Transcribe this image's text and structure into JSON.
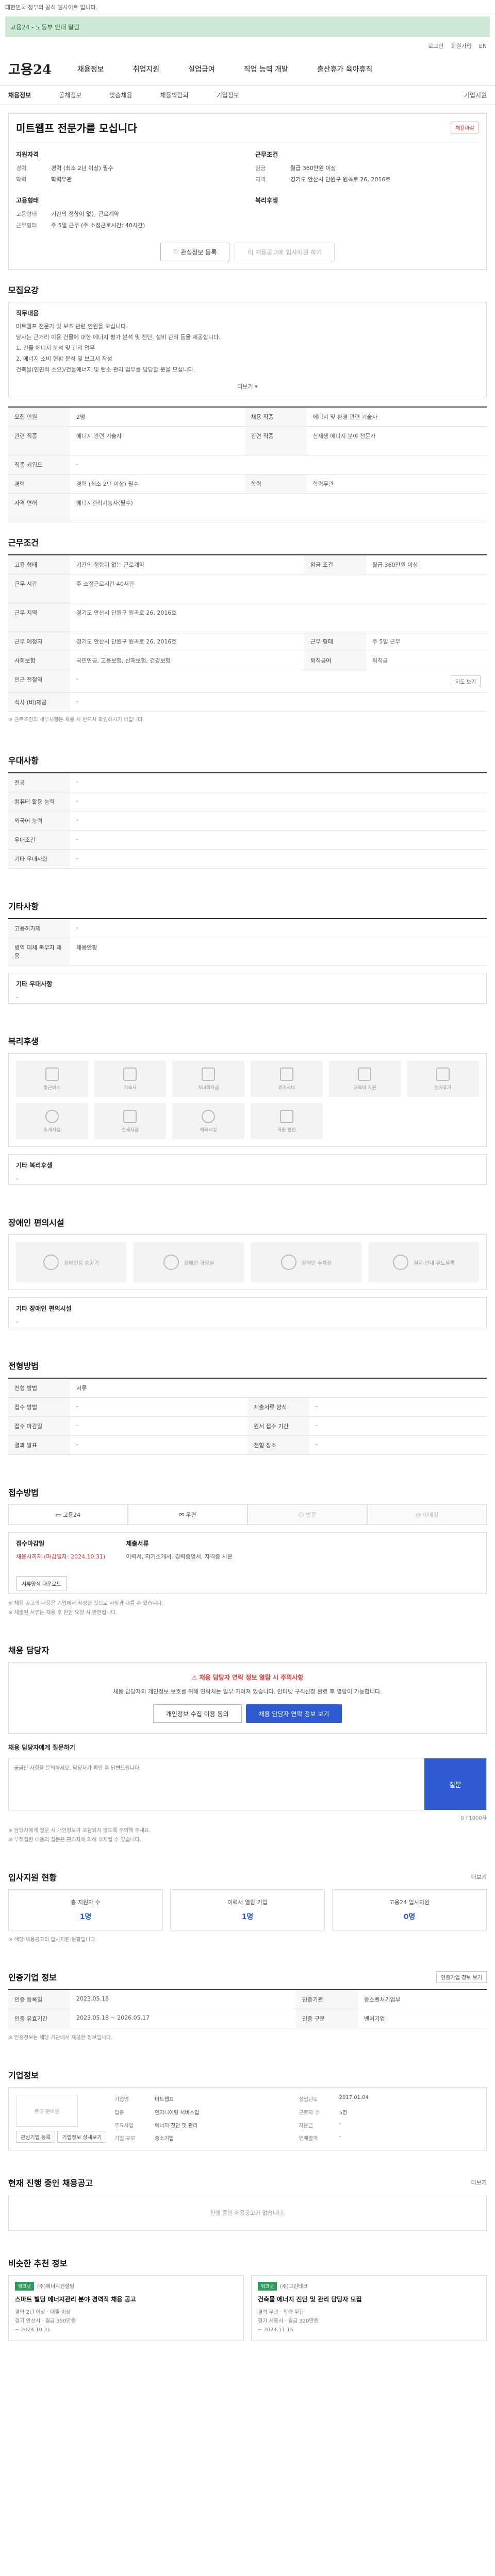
{
  "top": {
    "notice": "대한민국 정부의 공식 웹사이트 입니다.",
    "banner": "고용24 - 노동부 안내 알림",
    "util": [
      "로그인",
      "회원가입",
      "EN"
    ]
  },
  "gnb": {
    "logo": "고용24",
    "menu": [
      "채용정보",
      "취업지원",
      "실업급여",
      "직업 능력 개발",
      "출산휴가 육아휴직"
    ]
  },
  "subnav": [
    "채용정보",
    "공채정보",
    "맞춤채용",
    "채용박람회",
    "기업정보",
    "기업지원"
  ],
  "job": {
    "title": "미트웹프 전문가를 모십니다",
    "badge": "채용마감",
    "summary_left_title": "지원자격",
    "summary_left": [
      {
        "k": "경력",
        "v": "경력 (최소 2년 이상) 필수"
      },
      {
        "k": "학력",
        "v": "학력무관"
      }
    ],
    "summary_right_title": "근무조건",
    "summary_right": [
      {
        "k": "임금",
        "v": "월급 360만원 이상"
      },
      {
        "k": "지역",
        "v": "경기도 안산시 단원구 원곡로 26, 2016호"
      }
    ],
    "summary_left2_title": "고용형태",
    "summary_left2": [
      {
        "k": "고용형태",
        "v": "기간의 정함이 없는 근로계약"
      },
      {
        "k": "근무형태",
        "v": "주 5일 근무 (주 소정근로시간: 40시간)"
      }
    ],
    "summary_right2_title": "복리후생",
    "summary_right2": [],
    "btn_save": "관심정보 등록",
    "btn_apply": "이 채용공고에 입사지원 하기"
  },
  "recruit": {
    "title": "모집요강",
    "box_label": "직무내용",
    "lines": [
      "미트웹프 전문가 및 보조 관련 인원을 모십니다.",
      "당사는 근거리 이용 건물에 대한 에너지 평가 분석 및 진단, 설비 관리 등을 제공합니다.",
      "1. 건물 에너지 분석 및 관리 업무",
      "2. 에너지 소비 현황 분석 및 보고서 작성",
      "건축물(연면적 소요)/건물에너지 및 탄소 관리 업무를 담당할 분을 모십니다."
    ],
    "more": "더보기"
  },
  "recruit_table": [
    {
      "k": "모집 인원",
      "v": "2명",
      "k2": "채용 직종",
      "v2": "에너지 및 환경 관련 기술자"
    },
    {
      "k": "관련 직종",
      "v": "에너지 관련 기술자",
      "k2": "관련 직종",
      "v2": "신재생 에너지 분야 전문가"
    },
    {
      "k": "직종 키워드",
      "v": "-",
      "k2": "",
      "v2": ""
    },
    {
      "k": "경력",
      "v": "경력 (최소 2년 이상) 필수",
      "k2": "학력",
      "v2": "학력무관"
    },
    {
      "k": "자격 면허",
      "v": "에너지관리기능사(필수)",
      "k2": "",
      "v2": ""
    }
  ],
  "work": {
    "title": "근무조건",
    "rows": [
      {
        "k": "고용 형태",
        "v": "기간의 정함이 없는 근로계약",
        "k2": "임금 조건",
        "v2": "월급 360만원 이상"
      },
      {
        "k": "근무 시간",
        "v": "주 소정근로시간 40시간",
        "k2": "",
        "v2": ""
      },
      {
        "k": "근무 지역",
        "v": "경기도 안산시 단원구 원곡로 26, 2016호",
        "k2": "",
        "v2": ""
      },
      {
        "k": "근무 예정지",
        "v": "경기도 안산시 단원구 원곡로 26, 2016호",
        "k2": "근무 형태",
        "v2": "주 5일 근무"
      },
      {
        "k": "사회보험",
        "v": "국민연금, 고용보험, 산재보험, 건강보험",
        "k2": "퇴직급여",
        "v2": "퇴직금"
      },
      {
        "k": "인근 전철역",
        "v": "-",
        "k2": "",
        "v2": ""
      },
      {
        "k": "식사 (비)제공",
        "v": "-",
        "k2": "",
        "v2": ""
      }
    ],
    "map_btn": "지도 보기",
    "note": "※ 근로조건의 세부사항은 채용 시 반드시 확인하시기 바랍니다."
  },
  "preference": {
    "title": "우대사항",
    "rows": [
      {
        "k": "전공",
        "v": "-"
      },
      {
        "k": "컴퓨터 활용 능력",
        "v": "-"
      },
      {
        "k": "외국어 능력",
        "v": "-"
      },
      {
        "k": "우대조건",
        "v": "-"
      },
      {
        "k": "기타 우대사항",
        "v": "-"
      }
    ]
  },
  "other": {
    "title": "기타사항",
    "rows": [
      {
        "k": "고용허가제",
        "v": "-"
      },
      {
        "k": "병역 대체 복무자 채용",
        "v": "채용안함"
      }
    ],
    "extra_label": "기타 우대사항",
    "extra_value": "-"
  },
  "welfare": {
    "title": "복리후생",
    "items": [
      "통근버스",
      "기숙사",
      "자녀학자금",
      "경조사비",
      "교육비 지원",
      "연차휴가",
      "휴게시설",
      "전세자금",
      "체육시설",
      "직원 할인"
    ],
    "extra_label": "기타 복리후생",
    "extra_value": "-"
  },
  "disability": {
    "title": "장애인 편의시설",
    "items": [
      "장애인용 승강기",
      "장애인 화장실",
      "장애인 주차장",
      "점자 안내 유도블록"
    ],
    "extra_label": "기타 장애인 편의시설",
    "extra_value": "-"
  },
  "process": {
    "title": "전형방법",
    "rows": [
      {
        "k": "전형 방법",
        "v": "서류",
        "k2": "",
        "v2": ""
      },
      {
        "k": "접수 방법",
        "v": "-",
        "k2": "제출서류 양식",
        "v2": "-"
      },
      {
        "k": "접수 마감일",
        "v": "-",
        "k2": "원서 접수 기간",
        "v2": "-"
      },
      {
        "k": "결과 발표",
        "v": "-",
        "k2": "전형 장소",
        "v2": "-"
      }
    ]
  },
  "apply": {
    "title": "접수방법",
    "methods": [
      "고용24",
      "우편",
      "방문",
      "이메일"
    ],
    "deadline_label": "접수마감일",
    "deadline_value": "채용시까지 (마감일자: 2024.10.31)",
    "docs_label": "제출서류",
    "docs_value": "이력서, 자기소개서, 경력증명서, 자격증 사본",
    "form_btn": "서류양식 다운로드",
    "notes": [
      "※ 채용 공고의 내용은 기업에서 작성한 것으로 사실과 다를 수 있습니다.",
      "※ 제출된 서류는 채용 후 반환 요청 시 반환됩니다."
    ]
  },
  "manager": {
    "title": "채용 담당자",
    "alert_title": "채용 담당자 연락 정보 열람 시 주의사항",
    "alert_text": "채용 담당자의 개인정보 보호를 위해 연락처는 일부 가려져 있습니다. 인터넷 구직신청 완료 후 열람이 가능합니다.",
    "btn_1": "개인정보 수집 이용 동의",
    "btn_2": "채용 담당자 연락 정보 보기",
    "qa_label": "채용 담당자에게 질문하기",
    "qa_placeholder": "궁금한 사항을 문의하세요. 담당자가 확인 후 답변드립니다.",
    "qa_btn": "질문",
    "qa_count": "0 / 1000자",
    "notes": [
      "※ 담당자에게 질문 시 개인정보가 포함되지 않도록 주의해 주세요.",
      "※ 부적절한 내용의 질문은 관리자에 의해 삭제될 수 있습니다."
    ]
  },
  "stats": {
    "title": "입사지원 현황",
    "more": "더보기",
    "cards": [
      {
        "label": "총 지원자 수",
        "num": "1명"
      },
      {
        "label": "이력서 열람 기업",
        "num": "1명"
      },
      {
        "label": "고용24 입사지원",
        "num": "0명"
      }
    ],
    "note": "※ 해당 채용공고의 입사지원 현황입니다."
  },
  "cert": {
    "title": "인증기업 정보",
    "btn": "인증기업 정보 보기",
    "rows": [
      {
        "k": "인증 등록일",
        "v": "2023.05.18",
        "k2": "인증기관",
        "v2": "중소벤처기업부"
      },
      {
        "k": "인증 유효기간",
        "v": "2023.05.18 ~ 2026.05.17",
        "k2": "인증 구분",
        "v2": "벤처기업"
      }
    ],
    "note": "※ 인증정보는 해당 기관에서 제공한 정보입니다."
  },
  "company": {
    "title": "기업정보",
    "logo": "로고 준비중",
    "btn1": "관심기업 등록",
    "btn2": "기업정보 상세보기",
    "rows": [
      {
        "k": "기업명",
        "v": "미트웹프"
      },
      {
        "k": "설립년도",
        "v": "2017.01.04"
      },
      {
        "k": "업종",
        "v": "엔지니어링 서비스업"
      },
      {
        "k": "근로자 수",
        "v": "5명"
      },
      {
        "k": "주요사업",
        "v": "에너지 진단 및 관리"
      },
      {
        "k": "자본금",
        "v": "-"
      },
      {
        "k": "기업 규모",
        "v": "중소기업"
      },
      {
        "k": "연매출액",
        "v": "-"
      }
    ]
  },
  "others": {
    "title": "현재 진행 중인 채용공고",
    "more": "더보기",
    "empty": "진행 중인 채용공고가 없습니다."
  },
  "rec": {
    "title": "비슷한 추천 정보",
    "cards": [
      {
        "tag": "워크넷",
        "co": "(주)에너지컨설팅",
        "title": "스마트 빌딩 에너지관리 분야 경력직 채용 공고",
        "meta": [
          "경력 2년 이상 · 대졸 이상",
          "경기 안산시 · 월급 350만원",
          "~ 2024.10.31"
        ]
      },
      {
        "tag": "워크넷",
        "co": "(주)그린테크",
        "title": "건축물 에너지 진단 및 관리 담당자 모집",
        "meta": [
          "경력 무관 · 학력 무관",
          "경기 시흥시 · 월급 320만원",
          "~ 2024.11.15"
        ]
      }
    ]
  }
}
